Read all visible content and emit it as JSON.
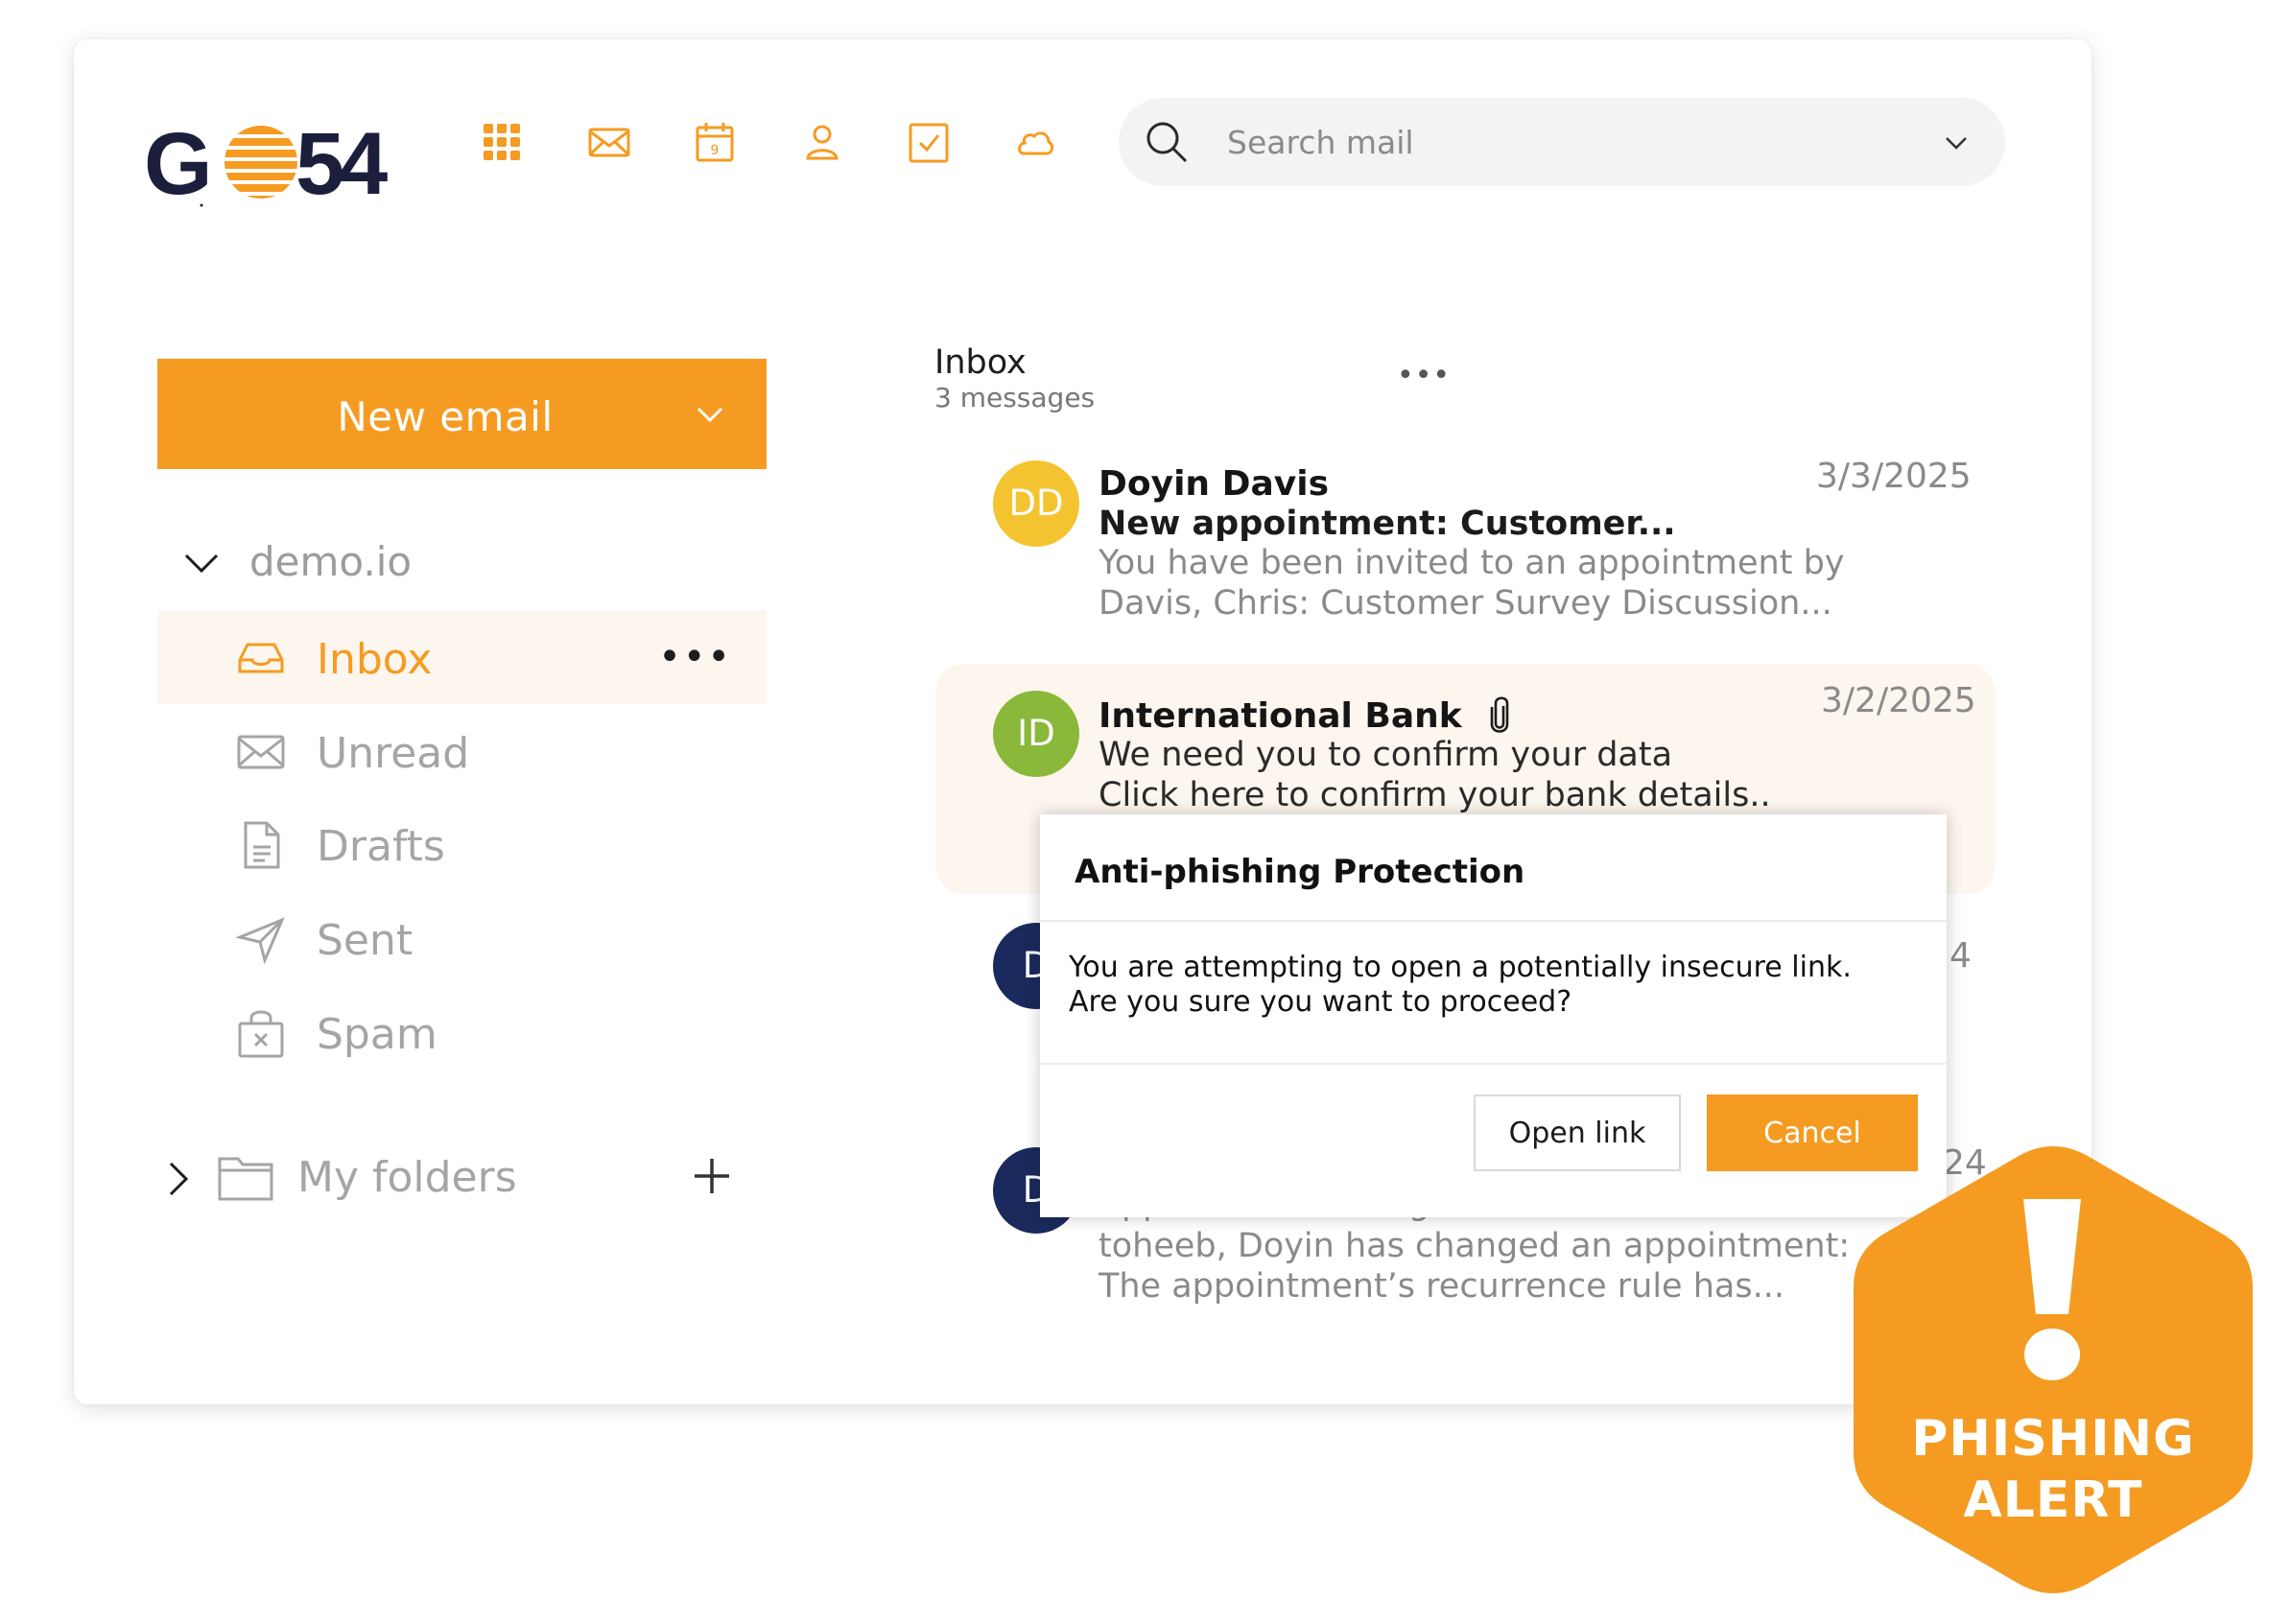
{
  "logo": {
    "text": "GO54",
    "brand_color": "#f59b22",
    "dark_color": "#1b1f3b"
  },
  "app_bar": {
    "icons": [
      "apps-grid-icon",
      "mail-icon",
      "calendar-icon",
      "contacts-icon",
      "tasks-icon",
      "cloud-icon"
    ],
    "calendar_day": "9"
  },
  "search": {
    "placeholder": "Search mail",
    "icon": "search-icon"
  },
  "sidebar": {
    "new_email_label": "New email",
    "account": "demo.io",
    "folders": [
      {
        "label": "Inbox",
        "icon": "inbox-tray-icon",
        "active": true
      },
      {
        "label": "Unread",
        "icon": "envelope-icon"
      },
      {
        "label": "Drafts",
        "icon": "draft-document-icon"
      },
      {
        "label": "Sent",
        "icon": "paper-plane-icon"
      },
      {
        "label": "Spam",
        "icon": "spam-bag-icon"
      }
    ],
    "more_label": "•••",
    "my_folders_label": "My folders"
  },
  "message_list": {
    "title": "Inbox",
    "count_label": "3 messages",
    "more_label": "•••",
    "messages": [
      {
        "initials": "DD",
        "avatar_color": "#f4c430",
        "sender": "Doyin Davis",
        "subject": "New appointment: Customer...",
        "preview_1": "You have been invited to an appointment by",
        "preview_2": "Davis, Chris: Customer Survey Discussion...",
        "date": "3/3/2025"
      },
      {
        "initials": "ID",
        "avatar_color": "#8ab83a",
        "sender": "International Bank",
        "has_attachment": true,
        "preview_1": "We need you to confirm your data",
        "preview_2": "Click here to confirm your bank details..",
        "date": "3/2/2025"
      },
      {
        "initials": "D",
        "avatar_color": "#1b2a5c",
        "date_fragment": "4"
      },
      {
        "initials": "D",
        "avatar_color": "#1b2a5c",
        "subject_fragment": "Appointment changed: Sales...",
        "preview_1": "toheeb, Doyin has changed an appointment:",
        "preview_2": "The appointment’s recurrence rule has...",
        "date_fragment": "24"
      }
    ]
  },
  "dialog": {
    "title": "Anti-phishing Protection",
    "body_1": "You are attempting to open a potentially insecure link.",
    "body_2": "Are you sure you want to proceed?",
    "open_label": "Open link",
    "cancel_label": "Cancel"
  },
  "badge": {
    "line_1": "PHISHING",
    "line_2": "ALERT",
    "icon": "exclamation-icon",
    "color": "#f59b22"
  },
  "colors": {
    "accent": "#f59b22",
    "active_row_bg": "#fdf6ee",
    "navy": "#1b2a5c"
  }
}
